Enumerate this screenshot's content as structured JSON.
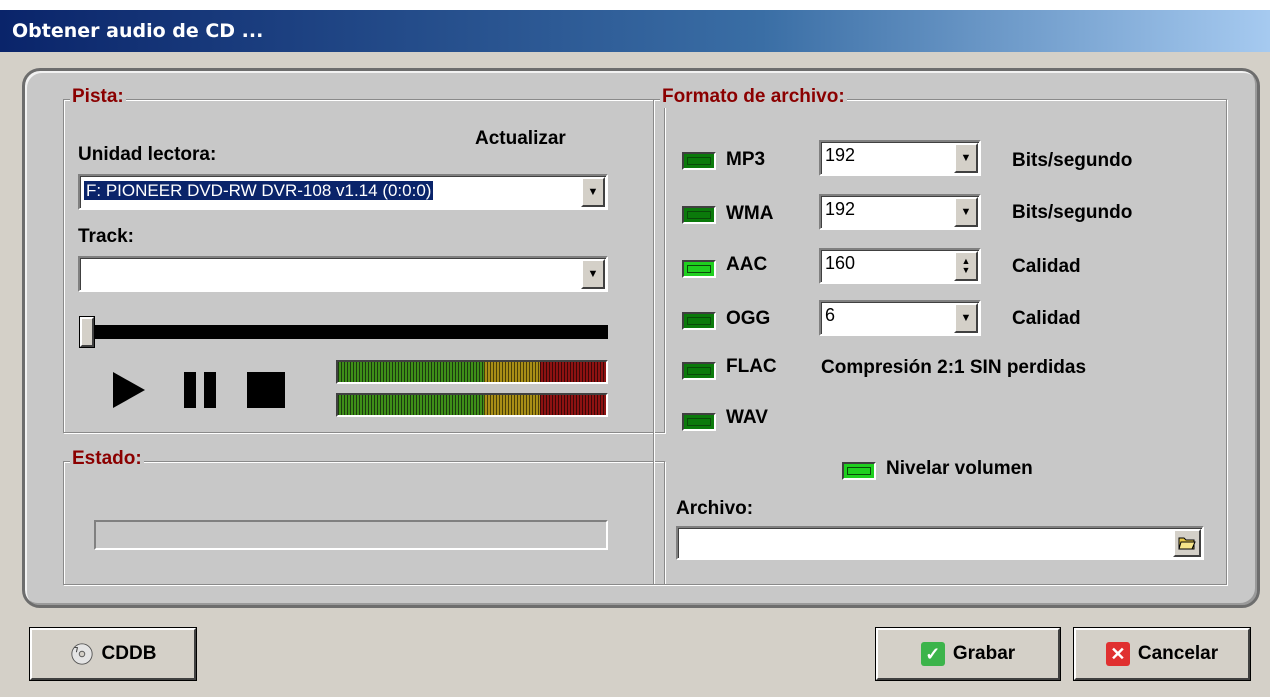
{
  "window": {
    "title": "Obtener audio de CD ..."
  },
  "pista": {
    "group_title": "Pista:",
    "drive_label": "Unidad lectora:",
    "refresh_label": "Actualizar",
    "drive_value": "F: PIONEER DVD-RW  DVR-108 v1.14 (0:0:0)",
    "track_label": "Track:",
    "track_value": "",
    "seek_position": 0
  },
  "estado": {
    "group_title": "Estado:",
    "progress": 0
  },
  "formato": {
    "group_title": "Formato de archivo:",
    "rows": [
      {
        "name": "MP3",
        "value": "192",
        "unit": "Bits/segundo",
        "active": false
      },
      {
        "name": "WMA",
        "value": "192",
        "unit": "Bits/segundo",
        "active": false
      },
      {
        "name": "AAC",
        "value": "160",
        "unit": "Calidad",
        "active": true
      },
      {
        "name": "OGG",
        "value": "6",
        "unit": "Calidad",
        "active": false
      },
      {
        "name": "FLAC",
        "note": "Compresión 2:1 SIN perdidas",
        "active": false
      },
      {
        "name": "WAV",
        "active": false
      }
    ],
    "normalize_label": "Nivelar volumen",
    "normalize_active": true,
    "file_label": "Archivo:",
    "file_value": ""
  },
  "buttons": {
    "cddb": "CDDB",
    "grabar": "Grabar",
    "cancelar": "Cancelar"
  },
  "colors": {
    "title_bar": "#0a246a",
    "group_title": "#8b0000",
    "led_on": "#1fd01f",
    "led_off": "#0b7a0b"
  }
}
